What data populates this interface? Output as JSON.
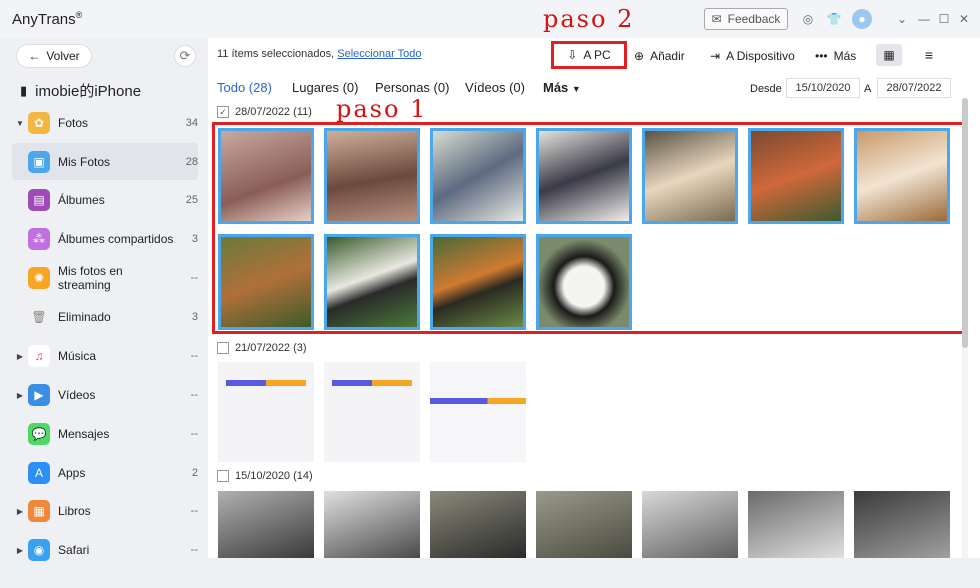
{
  "app": {
    "title": "AnyTrans",
    "reg": "®",
    "feedback": "Feedback"
  },
  "sidebar": {
    "back": "Volver",
    "device": "imobie的iPhone",
    "items": [
      {
        "label": "Fotos",
        "count": "34",
        "icon": "photos-icon",
        "color": "#f0a040"
      },
      {
        "label": "Mis Fotos",
        "count": "28",
        "icon": "my-photos-icon",
        "color": "#4aa8ea"
      },
      {
        "label": "Álbumes",
        "count": "25",
        "icon": "albums-icon",
        "color": "#a04ab8"
      },
      {
        "label": "Álbumes compartidos",
        "count": "3",
        "icon": "shared-albums-icon",
        "color": "#b060d0"
      },
      {
        "label": "Mis fotos en streaming",
        "count": "--",
        "icon": "photo-stream-icon",
        "color": "#f6a623"
      },
      {
        "label": "Eliminado",
        "count": "3",
        "icon": "trash-icon",
        "color": "#999999"
      },
      {
        "label": "Música",
        "count": "--",
        "icon": "music-icon",
        "color": "#f5425a"
      },
      {
        "label": "Vídeos",
        "count": "--",
        "icon": "videos-icon",
        "color": "#3a8ee6"
      },
      {
        "label": "Mensajes",
        "count": "--",
        "icon": "messages-icon",
        "color": "#4cd964"
      },
      {
        "label": "Apps",
        "count": "2",
        "icon": "apps-icon",
        "color": "#2b8ff5"
      },
      {
        "label": "Libros",
        "count": "--",
        "icon": "books-icon",
        "color": "#f0883a"
      },
      {
        "label": "Safari",
        "count": "--",
        "icon": "safari-icon",
        "color": "#3aa0f0"
      }
    ]
  },
  "toolbar": {
    "selected_text": "11 ítems seleccionados,",
    "select_all": "Seleccionar Todo",
    "to_pc": "A PC",
    "add": "Añadir",
    "to_device": "A Dispositivo",
    "more": "Más"
  },
  "filters": {
    "all": "Todo (28)",
    "places": "Lugares (0)",
    "people": "Personas (0)",
    "videos": "Vídeos (0)",
    "more": "Más",
    "from_label": "Desde",
    "from_date": "15/10/2020",
    "to_label": "A",
    "to_date": "28/07/2022"
  },
  "groups": {
    "g1": "28/07/2022 (11)",
    "g2": "21/07/2022 (3)",
    "g3": "15/10/2020 (14)"
  },
  "annotations": {
    "step1": "paso 1",
    "step2": "paso 2"
  },
  "colors": {
    "accent": "#2b66c7",
    "selection": "#4aa8ea",
    "annotation": "#e02020"
  }
}
